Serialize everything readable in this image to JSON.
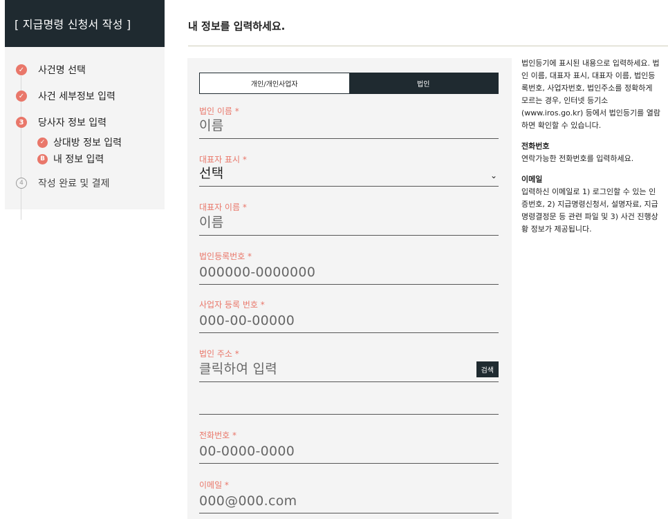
{
  "sidebar": {
    "title": "[ 지급명령 신청서 작성 ]",
    "steps": [
      {
        "label": "사건명 선택",
        "status": "done"
      },
      {
        "label": "사건 세부정보 입력",
        "status": "done"
      },
      {
        "label": "당사자 정보 입력",
        "status": "current",
        "number": "3"
      },
      {
        "label": "작성 완료 및 결제",
        "status": "pending",
        "number": "4"
      }
    ],
    "substeps": [
      {
        "label": "상대방 정보 입력",
        "status": "done"
      },
      {
        "label": "내 정보 입력",
        "status": "current",
        "number": "B"
      }
    ]
  },
  "main": {
    "title": "내 정보를 입력하세요."
  },
  "form": {
    "tabs": [
      {
        "label": "개인/개인사업자",
        "active": false
      },
      {
        "label": "법인",
        "active": true
      }
    ],
    "fields": {
      "corp_name": {
        "label": "법인 이름 *",
        "placeholder": "이름"
      },
      "rep_title": {
        "label": "대표자 표시 *",
        "value": "선택"
      },
      "rep_name": {
        "label": "대표자 이름 *",
        "placeholder": "이름"
      },
      "corp_reg_no": {
        "label": "법인등록번호 *",
        "placeholder": "000000-0000000"
      },
      "biz_reg_no": {
        "label": "사업자 등록 번호 *",
        "placeholder": "000-00-00000"
      },
      "corp_address": {
        "label": "법인 주소 *",
        "placeholder": "클릭하여 입력",
        "search_label": "검색"
      },
      "address_detail": {
        "placeholder": ""
      },
      "phone": {
        "label": "전화번호 *",
        "placeholder": "00-0000-0000"
      },
      "email": {
        "label": "이메일 *",
        "placeholder": "000@000.com"
      }
    }
  },
  "help": {
    "intro": "법인등기에 표시된 내용으로 입력하세요. 법인 이름, 대표자 표시, 대표자 이름, 법인등록번호, 사업자번호, 법인주소를 정확하게 모르는 경우, 인터넷 등기소(www.iros.go.kr) 등에서 법인등기를 열람하면 확인할 수 있습니다.",
    "phone_heading": "전화번호",
    "phone_text": "연락가능한 전화번호를 입력하세요.",
    "email_heading": "이메일",
    "email_text": "입력하신 이메일로 1) 로그인할 수 있는 인증번호, 2) 지급명령신청서, 설명자료, 지급명령결정문 등 관련 파일 및 3) 사건 진행상황 정보가 제공됩니다."
  },
  "colors": {
    "accent": "#e9776a",
    "dark": "#1f2a30",
    "panel": "#f4f4f4"
  }
}
